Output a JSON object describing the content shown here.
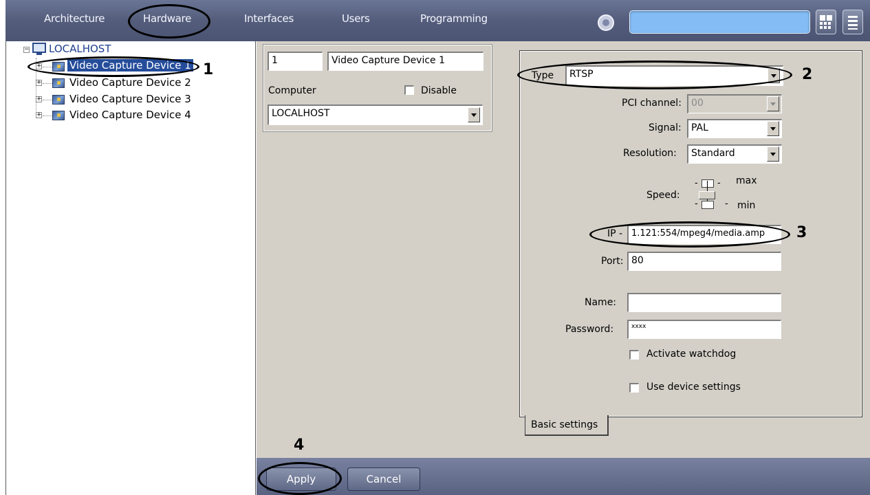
{
  "nav": {
    "tabs": [
      "Architecture",
      "Hardware",
      "Interfaces",
      "Users",
      "Programming"
    ],
    "selected": "Hardware"
  },
  "tree": {
    "root": "LOCALHOST",
    "devices": [
      "Video Capture Device 1",
      "Video Capture Device 2",
      "Video Capture Device 3",
      "Video Capture Device 4"
    ],
    "selected": "Video Capture Device 1"
  },
  "device": {
    "id": "1",
    "name": "Video Capture Device 1",
    "computer_label": "Computer",
    "disable_label": "Disable",
    "computer_value": "LOCALHOST"
  },
  "settings": {
    "type_label": "Type",
    "type_value": "RTSP",
    "pci_label": "PCI channel:",
    "pci_value": "00",
    "signal_label": "Signal:",
    "signal_value": "PAL",
    "resolution_label": "Resolution:",
    "resolution_value": "Standard",
    "speed_label": "Speed:",
    "speed_max": "max",
    "speed_min": "min",
    "ip_label": "IP -",
    "ip_value": "1.121:554/mpeg4/media.amp",
    "port_label": "Port:",
    "port_value": "80",
    "name_label": "Name:",
    "name_value": "",
    "password_label": "Password:",
    "password_value": "xxxx",
    "watchdog_label": "Activate watchdog",
    "use_device_label": "Use device settings",
    "tab_label": "Basic settings"
  },
  "buttons": {
    "apply": "Apply",
    "cancel": "Cancel"
  },
  "markers": [
    "1",
    "2",
    "3",
    "4"
  ],
  "colors": {
    "topbar": "#545d7b",
    "search_field": "#84bdf5",
    "dialog_bg": "#d4d0c8"
  }
}
